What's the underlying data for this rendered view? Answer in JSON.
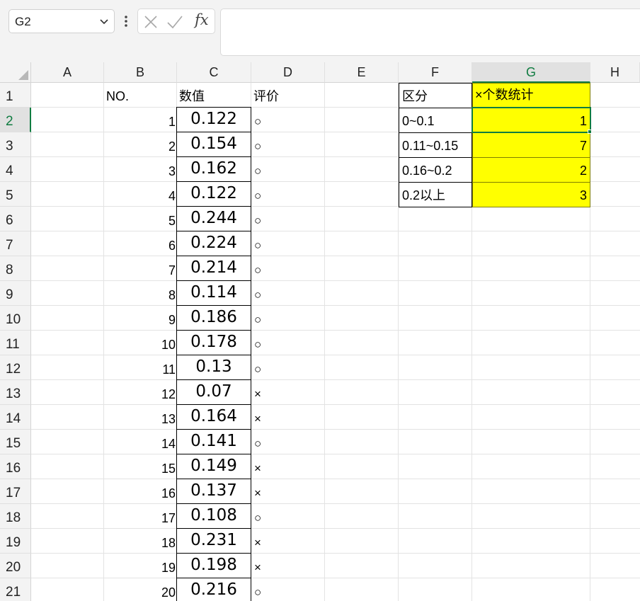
{
  "formula_bar": {
    "name_box": "G2",
    "fx_label": "fx",
    "formula": ""
  },
  "columns": [
    "A",
    "B",
    "C",
    "D",
    "E",
    "F",
    "G",
    "H"
  ],
  "selected_column": "G",
  "selected_row": 2,
  "rows": [
    "1",
    "2",
    "3",
    "4",
    "5",
    "6",
    "7",
    "8",
    "9",
    "10",
    "11",
    "12",
    "13",
    "14",
    "15",
    "16",
    "17",
    "18",
    "19",
    "20",
    "21"
  ],
  "headers": {
    "no": "NO.",
    "value": "数值",
    "evaluation": "评价",
    "range": "区分",
    "count": "×个数统计"
  },
  "table": [
    {
      "no": "1",
      "value": "0.122",
      "eval": "○"
    },
    {
      "no": "2",
      "value": "0.154",
      "eval": "○"
    },
    {
      "no": "3",
      "value": "0.162",
      "eval": "○"
    },
    {
      "no": "4",
      "value": "0.122",
      "eval": "○"
    },
    {
      "no": "5",
      "value": "0.244",
      "eval": "○"
    },
    {
      "no": "6",
      "value": "0.224",
      "eval": "○"
    },
    {
      "no": "7",
      "value": "0.214",
      "eval": "○"
    },
    {
      "no": "8",
      "value": "0.114",
      "eval": "○"
    },
    {
      "no": "9",
      "value": "0.186",
      "eval": "○"
    },
    {
      "no": "10",
      "value": "0.178",
      "eval": "○"
    },
    {
      "no": "11",
      "value": "0.13",
      "eval": "○"
    },
    {
      "no": "12",
      "value": "0.07",
      "eval": "×"
    },
    {
      "no": "13",
      "value": "0.164",
      "eval": "×"
    },
    {
      "no": "14",
      "value": "0.141",
      "eval": "○"
    },
    {
      "no": "15",
      "value": "0.149",
      "eval": "×"
    },
    {
      "no": "16",
      "value": "0.137",
      "eval": "×"
    },
    {
      "no": "17",
      "value": "0.108",
      "eval": "○"
    },
    {
      "no": "18",
      "value": "0.231",
      "eval": "×"
    },
    {
      "no": "19",
      "value": "0.198",
      "eval": "×"
    },
    {
      "no": "20",
      "value": "0.216",
      "eval": "○"
    }
  ],
  "summary": [
    {
      "range": "0~0.1",
      "count": "1"
    },
    {
      "range": "0.11~0.15",
      "count": "7"
    },
    {
      "range": "0.16~0.2",
      "count": "2"
    },
    {
      "range": "0.2以上",
      "count": "3"
    }
  ],
  "colors": {
    "accent": "#107c41",
    "highlight": "#ffff00"
  }
}
